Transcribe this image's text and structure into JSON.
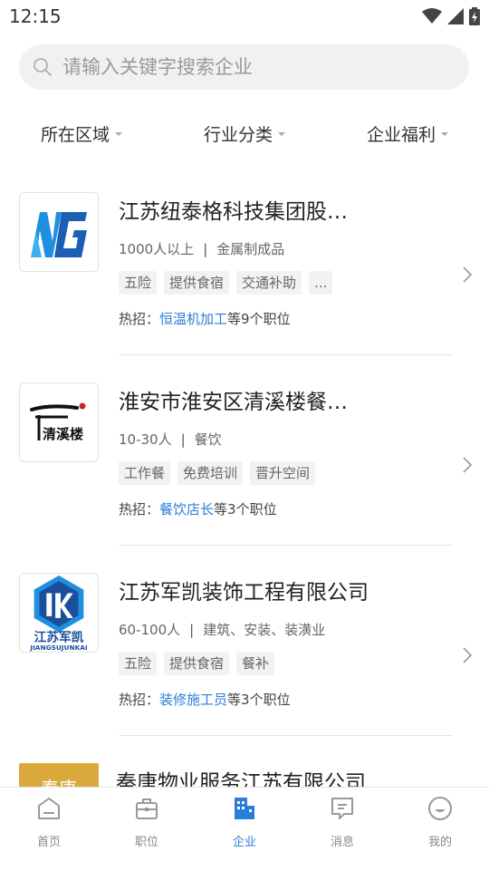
{
  "status_bar": {
    "time": "12:15"
  },
  "search": {
    "placeholder": "请输入关键字搜索企业"
  },
  "filters": [
    {
      "label": "所在区域"
    },
    {
      "label": "行业分类"
    },
    {
      "label": "企业福利"
    }
  ],
  "companies": [
    {
      "name": "江苏纽泰格科技集团股…",
      "size": "1000人以上",
      "industry": "金属制成品",
      "tags": [
        "五险",
        "提供食宿",
        "交通补助",
        "..."
      ],
      "hot_prefix": "热招：",
      "hot_job": "恒温机加工",
      "hot_suffix": "等9个职位",
      "logo_icon": "ntg-logo"
    },
    {
      "name": "淮安市淮安区清溪楼餐…",
      "size": "10-30人",
      "industry": "餐饮",
      "tags": [
        "工作餐",
        "免费培训",
        "晋升空间"
      ],
      "hot_prefix": "热招：",
      "hot_job": "餐饮店长",
      "hot_suffix": "等3个职位",
      "logo_text": "清溪楼",
      "logo_icon": "qingxilou-logo"
    },
    {
      "name": "江苏军凯装饰工程有限公司",
      "size": "60-100人",
      "industry": "建筑、安装、装潢业",
      "tags": [
        "五险",
        "提供食宿",
        "餐补"
      ],
      "hot_prefix": "热招：",
      "hot_job": "装修施工员",
      "hot_suffix": "等3个职位",
      "logo_text_cn": "江苏军凯",
      "logo_text_en": "JIANGSUJUNKAI",
      "logo_icon": "junkai-logo"
    },
    {
      "name": "秦唐物业服务江苏有限公司",
      "logo_text": "秦唐",
      "logo_icon": "qintang-logo"
    }
  ],
  "tabs": [
    {
      "label": "首页",
      "icon": "home-icon"
    },
    {
      "label": "职位",
      "icon": "briefcase-icon"
    },
    {
      "label": "企业",
      "icon": "building-icon",
      "active": true
    },
    {
      "label": "消息",
      "icon": "message-icon"
    },
    {
      "label": "我的",
      "icon": "profile-icon"
    }
  ],
  "colors": {
    "accent": "#2b7dd8",
    "tag_bg": "#f2f2f2",
    "search_bg": "#f1f1f1"
  }
}
